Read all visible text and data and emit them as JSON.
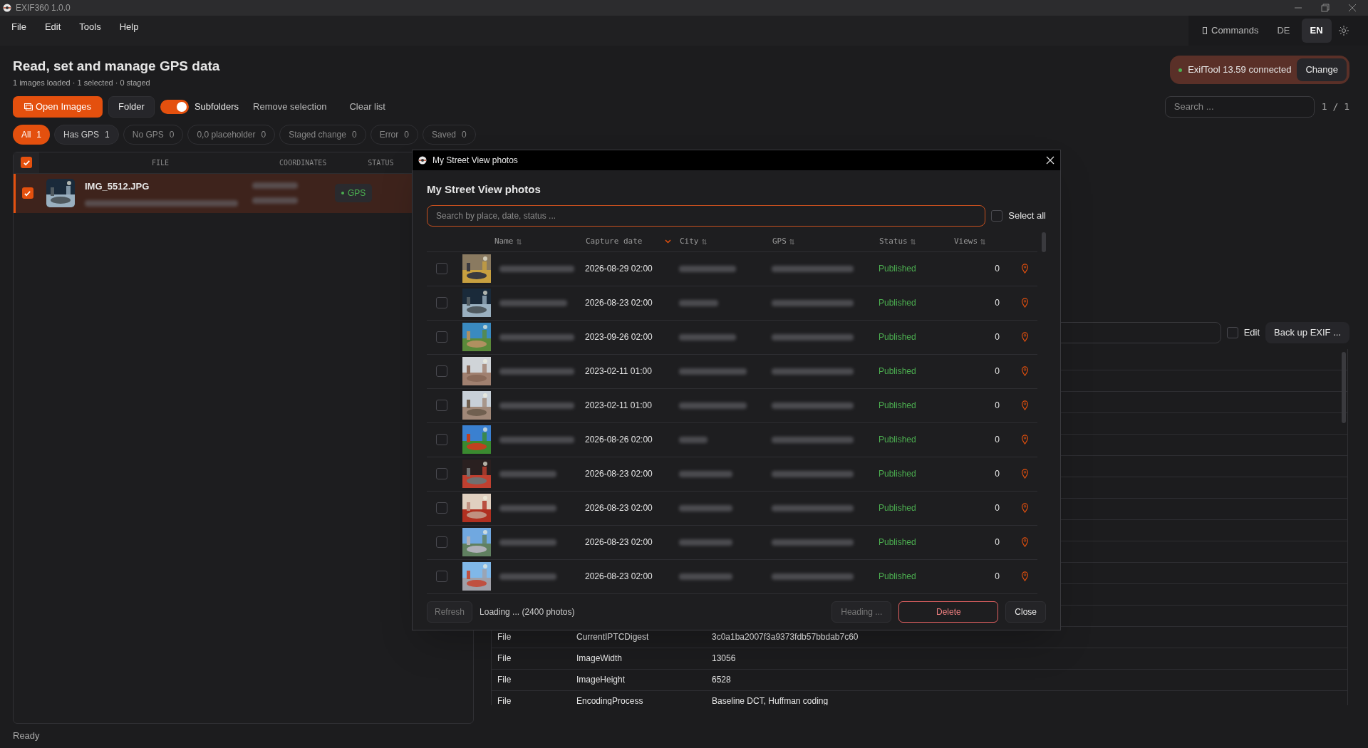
{
  "window": {
    "title": "EXIF360 1.0.0"
  },
  "menu": [
    "File",
    "Edit",
    "Tools",
    "Help"
  ],
  "topbar": {
    "commands": "Commands",
    "languages": [
      {
        "label": "DE",
        "selected": false
      },
      {
        "label": "EN",
        "selected": true
      }
    ]
  },
  "header": {
    "title": "Read, set and manage GPS data",
    "subtitle": "1 images loaded · 1 selected · 0 staged"
  },
  "exiftool": {
    "status": "ExifTool 13.59 connected",
    "connected": true,
    "button": "Change"
  },
  "toolbar": {
    "open": "Open Images",
    "folder": "Folder",
    "subfolders": {
      "label": "Subfolders",
      "on": true
    },
    "remove": "Remove selection",
    "clear": "Clear list"
  },
  "search": {
    "placeholder": "Search ...",
    "pager": "1 / 1"
  },
  "filters": [
    {
      "label": "All",
      "count": "1",
      "selected": true
    },
    {
      "label": "Has GPS",
      "count": "1",
      "selected": false
    },
    {
      "label": "No GPS",
      "count": "0",
      "selected": false
    },
    {
      "label": "0,0 placeholder",
      "count": "0",
      "selected": false
    },
    {
      "label": "Staged change",
      "count": "0",
      "selected": false
    },
    {
      "label": "Error",
      "count": "0",
      "selected": false
    },
    {
      "label": "Saved",
      "count": "0",
      "selected": false
    }
  ],
  "file_table": {
    "all_checked": true,
    "columns": [
      "FILE",
      "COORDINATES",
      "STATUS"
    ],
    "rows": [
      {
        "name": "IMG_5512.JPG",
        "checked": true,
        "selected": true,
        "status": "GPS"
      }
    ]
  },
  "details": {
    "edit": {
      "label": "Edit",
      "checked": false
    },
    "backup": "Back up EXIF ...",
    "rows": [
      {
        "group": "File",
        "tag": "CurrentIPTCDigest",
        "value": "3c0a1ba2007f3a9373fdb57bbdab7c60"
      },
      {
        "group": "File",
        "tag": "ImageWidth",
        "value": "13056"
      },
      {
        "group": "File",
        "tag": "ImageHeight",
        "value": "6528"
      },
      {
        "group": "File",
        "tag": "EncodingProcess",
        "value": "Baseline DCT, Huffman coding"
      }
    ]
  },
  "dialog": {
    "window_title": "My Street View photos",
    "title": "My Street View photos",
    "search_placeholder": "Search by place, date, status ...",
    "select_all": {
      "label": "Select all",
      "checked": false
    },
    "columns": [
      {
        "label": "Name",
        "sorted": false
      },
      {
        "label": "Capture date",
        "sorted": true
      },
      {
        "label": "City",
        "sorted": false
      },
      {
        "label": "GPS",
        "sorted": false
      },
      {
        "label": "Status",
        "sorted": false
      },
      {
        "label": "Views",
        "sorted": false
      }
    ],
    "rows": [
      {
        "checked": false,
        "date": "2026-08-29 02:00",
        "status": "Published",
        "views": "0"
      },
      {
        "checked": false,
        "date": "2026-08-23 02:00",
        "status": "Published",
        "views": "0"
      },
      {
        "checked": false,
        "date": "2023-09-26 02:00",
        "status": "Published",
        "views": "0"
      },
      {
        "checked": false,
        "date": "2023-02-11 01:00",
        "status": "Published",
        "views": "0"
      },
      {
        "checked": false,
        "date": "2023-02-11 01:00",
        "status": "Published",
        "views": "0"
      },
      {
        "checked": false,
        "date": "2026-08-26 02:00",
        "status": "Published",
        "views": "0"
      },
      {
        "checked": false,
        "date": "2026-08-23 02:00",
        "status": "Published",
        "views": "0"
      },
      {
        "checked": false,
        "date": "2026-08-23 02:00",
        "status": "Published",
        "views": "0"
      },
      {
        "checked": false,
        "date": "2026-08-23 02:00",
        "status": "Published",
        "views": "0"
      },
      {
        "checked": false,
        "date": "2026-08-23 02:00",
        "status": "Published",
        "views": "0"
      }
    ],
    "refresh": "Refresh",
    "loading": "Loading ... (2400 photos)",
    "heading": "Heading ...",
    "delete": "Delete",
    "close": "Close"
  },
  "status_bar": "Ready"
}
